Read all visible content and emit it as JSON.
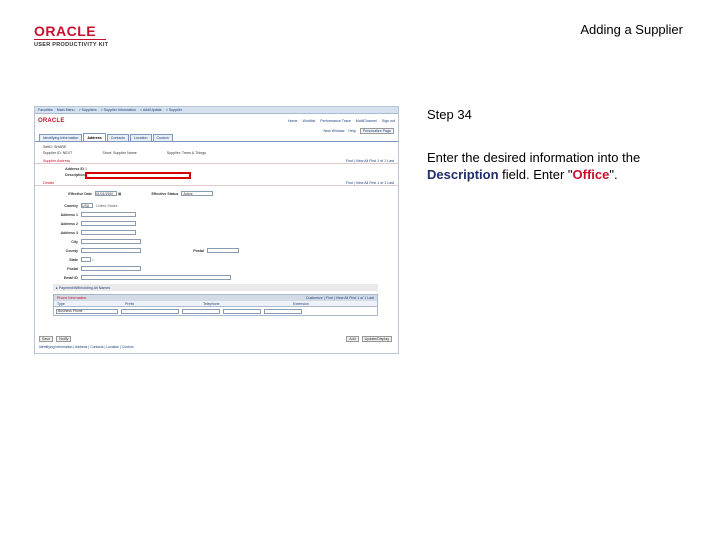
{
  "header": {
    "logo_word": "ORACLE",
    "logo_subtitle": "USER PRODUCTIVITY KIT",
    "doc_title": "Adding a Supplier"
  },
  "step": {
    "label": "Step 34",
    "instruction_pre": "Enter the desired information into the ",
    "field_name": "Description",
    "instruction_mid": " field. Enter \"",
    "value": "Office",
    "instruction_post": "\"."
  },
  "screenshot": {
    "top_nav": [
      "Favorites",
      "Main Menu",
      "> Suppliers",
      "> Supplier Information",
      "> Add/Update",
      "> Supplier"
    ],
    "logo": "ORACLE",
    "links": [
      "Home",
      "Worklist",
      "Performance Trace",
      "MultiChannel",
      "Sign out"
    ],
    "util": [
      "New Window",
      "Help",
      "Personalize Page"
    ],
    "tabs": [
      "Identifying Information",
      "Address",
      "Contacts",
      "Location",
      "Custom"
    ],
    "active_tab": "Address",
    "info": {
      "setid_label": "SetID: SHARE",
      "supplier_id_label": "Supplier ID: NEXT",
      "short_name_label": "Short: Supplier Name",
      "supplier_name_label": "Supplier: Trees & Things"
    },
    "section_vendor": "Supplier Address",
    "section_vendor_nav": "Find | View All    First 1 of 1 Last",
    "address_id_label": "Address ID",
    "address_id_value": "1",
    "description_label": "Description",
    "section_dated": "Details",
    "section_dated_nav": "Find | View All    First 1 of 1 Last",
    "effective_date_label": "Effective Date",
    "effective_date_value": "01/01/1900",
    "effective_status_label": "Effective Status",
    "effective_status_value": "Active",
    "country_label": "Country",
    "country_value": "USA",
    "country_desc": "United States",
    "address_rows": [
      "Address 1",
      "Address 2",
      "Address 3",
      "City",
      "County",
      "State",
      "Postal",
      "Email ID"
    ],
    "postal_label": "Postal",
    "note": "Payment/Withholding Alt Names",
    "phone_grid": {
      "title": "Phone Information",
      "nav": "Customize | Find | View All    First 1 of 1 Last",
      "columns": [
        "Type",
        "Prefix",
        "Telephone",
        "Extension"
      ],
      "type_value": "Business Phone"
    },
    "buttons": [
      "Save",
      "Notify"
    ],
    "buttons_right": [
      "Add",
      "Update/Display"
    ],
    "footer": "Identifying Information | Address | Contacts | Location | Custom"
  },
  "colors": {
    "brand_red": "#c8102e",
    "strong_blue": "#1f2d6b",
    "highlight_red": "#d90000"
  }
}
